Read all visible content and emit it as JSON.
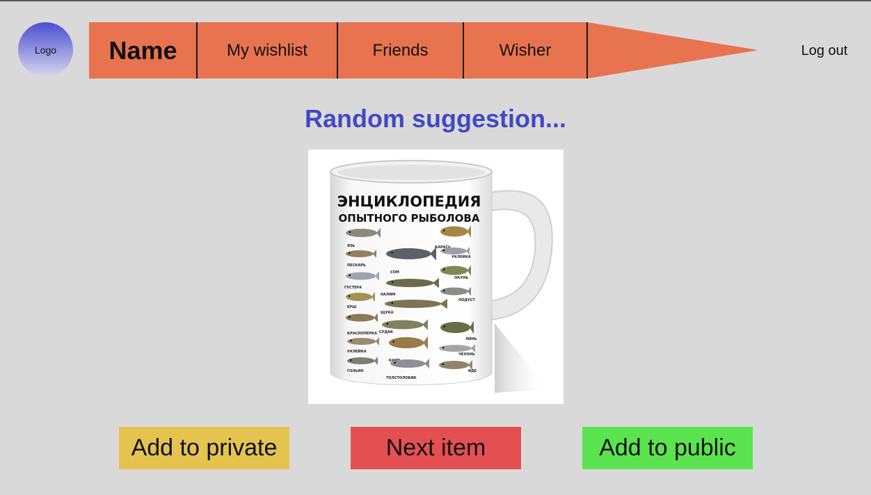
{
  "logo": {
    "label": "Logo"
  },
  "nav": {
    "name": "Name",
    "items": [
      {
        "label": "My wishlist"
      },
      {
        "label": "Friends"
      },
      {
        "label": "Wisher"
      }
    ],
    "color": "#e8734f"
  },
  "logout_label": "Log out",
  "main": {
    "title": "Random suggestion...",
    "product": {
      "mug_heading_line1": "ЭНЦИКЛОПЕДИЯ",
      "mug_heading_line2": "ОПЫТНОГО РЫБОЛОВА",
      "fish_names": [
        "ЯЗЬ",
        "ПЕСКАРЬ",
        "ГУСТЕРА",
        "ЕРШ",
        "КРАСНОПЕРКА",
        "УКЛЕЙКА",
        "ГОЛЬЯН",
        "СОМ",
        "НАЛИМ",
        "ЩУКА",
        "СУДАК",
        "КАРП",
        "ТОЛСТОЛОБИК",
        "КАРАСЬ",
        "УКЛЕЙКА",
        "ОКУНЬ",
        "ПОДУСТ",
        "ЛИНЬ",
        "ЧЕХОНЬ",
        "ИДЕ"
      ]
    }
  },
  "buttons": {
    "private": {
      "label": "Add to private",
      "color": "#e4c34f"
    },
    "next": {
      "label": "Next item",
      "color": "#e45052"
    },
    "public": {
      "label": "Add to public",
      "color": "#5be44f"
    }
  }
}
